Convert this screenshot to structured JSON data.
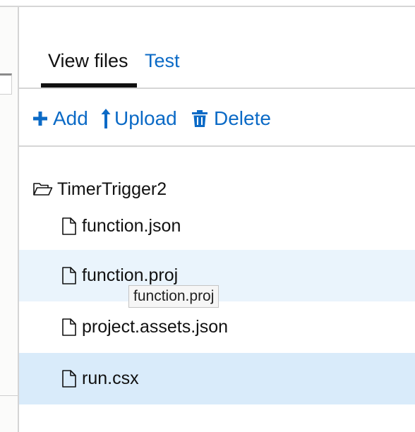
{
  "tabs": {
    "view_files": "View files",
    "test": "Test"
  },
  "toolbar": {
    "add_label": "Add",
    "upload_label": "Upload",
    "delete_label": "Delete"
  },
  "tree": {
    "folder": "TimerTrigger2",
    "files": [
      "function.json",
      "function.proj",
      "project.assets.json",
      "run.csx"
    ]
  },
  "tooltip": "function.proj",
  "colors": {
    "link": "#0b6ac6",
    "hover_row": "#eaf4fc",
    "selected_row": "#d9ebfa"
  }
}
